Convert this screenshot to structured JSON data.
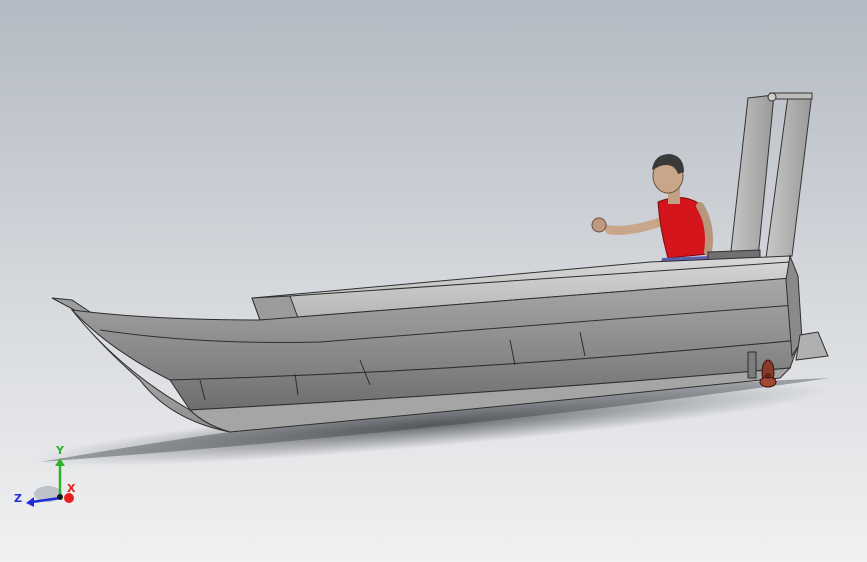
{
  "viewport": {
    "background_top": "#b4bac3",
    "background_bottom": "#f1f1f2"
  },
  "model": {
    "hull_color": "#8e8e8e",
    "shirt_color": "#d4151c",
    "propeller_color": "#8a3a2a"
  },
  "triad": {
    "x_label": "X",
    "y_label": "Y",
    "z_label": "Z",
    "x_color": "#e81f1f",
    "y_color": "#2fb12f",
    "z_color": "#1f2fd8"
  }
}
